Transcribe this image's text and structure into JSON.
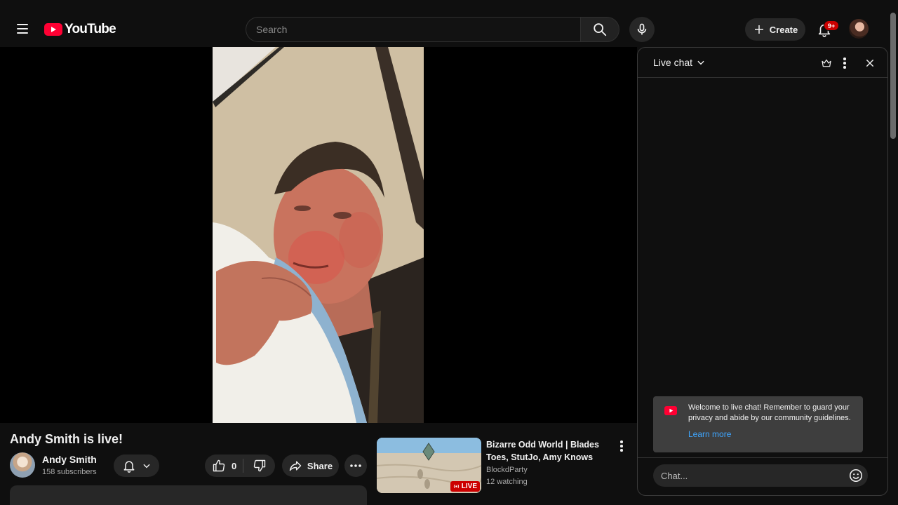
{
  "masthead": {
    "logo_text": "YouTube",
    "search_placeholder": "Search",
    "create_label": "Create",
    "notification_count": "9+",
    "icons": [
      "menu-icon",
      "search-icon",
      "mic-icon",
      "plus-icon",
      "bell-icon"
    ]
  },
  "video": {
    "title": "Andy Smith is live!",
    "owner_name": "Andy Smith",
    "owner_subscribers": "158 subscribers",
    "like_count": "0",
    "share_label": "Share"
  },
  "related": {
    "title": "Bizarre Odd World | Blades Toes, StutJo, Amy Knows",
    "channel": "BlockdParty",
    "watching": "12 watching",
    "badge": "LIVE"
  },
  "chat": {
    "title": "Live chat",
    "welcome_text": "Welcome to live chat! Remember to guard your privacy and abide by our community guidelines.",
    "learn_more": "Learn more",
    "input_placeholder": "Chat..."
  },
  "colors": {
    "background": "#0f0f0f",
    "brand_red": "#ff0033",
    "link_blue": "#3ea6ff",
    "pill_gray": "#272727"
  }
}
